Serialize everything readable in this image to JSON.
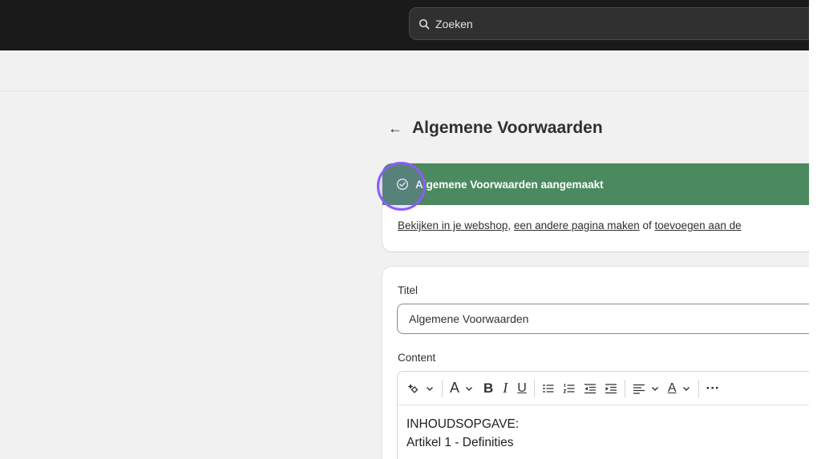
{
  "topbar": {
    "search": {
      "placeholder": "Zoeken"
    }
  },
  "page": {
    "back_symbol": "←",
    "title": "Algemene Voorwaarden"
  },
  "banner": {
    "title": "Algemene Voorwaarden aangemaakt",
    "links": {
      "view": "Bekijken in je webshop",
      "create": "een andere pagina maken",
      "or": "of",
      "add": "toevoegen aan de"
    },
    "accent_color": "#4b8a5e"
  },
  "form": {
    "title_label": "Titel",
    "title_value": "Algemene Voorwaarden",
    "content_label": "Content",
    "toolbar": {
      "font_letter": "A",
      "bold": "B",
      "italic": "I",
      "underline": "U",
      "color_letter": "A",
      "more": "···"
    },
    "content_lines": [
      "INHOUDSOPGAVE:",
      "Artikel 1 - Definities"
    ]
  },
  "highlight": {
    "color": "#8b5cf6"
  }
}
